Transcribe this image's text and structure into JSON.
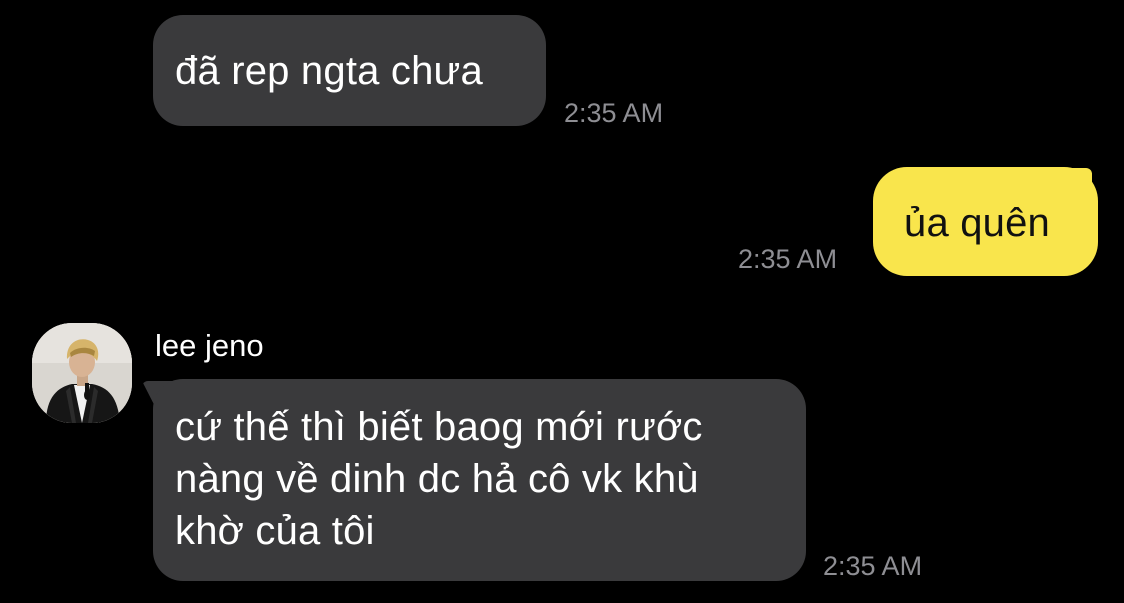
{
  "conversation": {
    "messages": [
      {
        "direction": "incoming",
        "text": "đã rep ngta chưa",
        "time": "2:35 AM"
      },
      {
        "direction": "outgoing",
        "text": "ủa quên",
        "time": "2:35 AM"
      },
      {
        "direction": "incoming",
        "sender": "lee jeno",
        "lines": [
          "cứ thế thì biết baog mới rước",
          "nàng về dinh dc hả cô vk khù",
          "khờ của tôi"
        ],
        "time": "2:35 AM"
      }
    ]
  },
  "colors": {
    "background": "#000000",
    "incoming_bubble": "#3a3a3c",
    "outgoing_bubble": "#f9e54c",
    "timestamp": "#8e8e93"
  },
  "icons": {
    "avatar": "profile-photo-icon"
  }
}
